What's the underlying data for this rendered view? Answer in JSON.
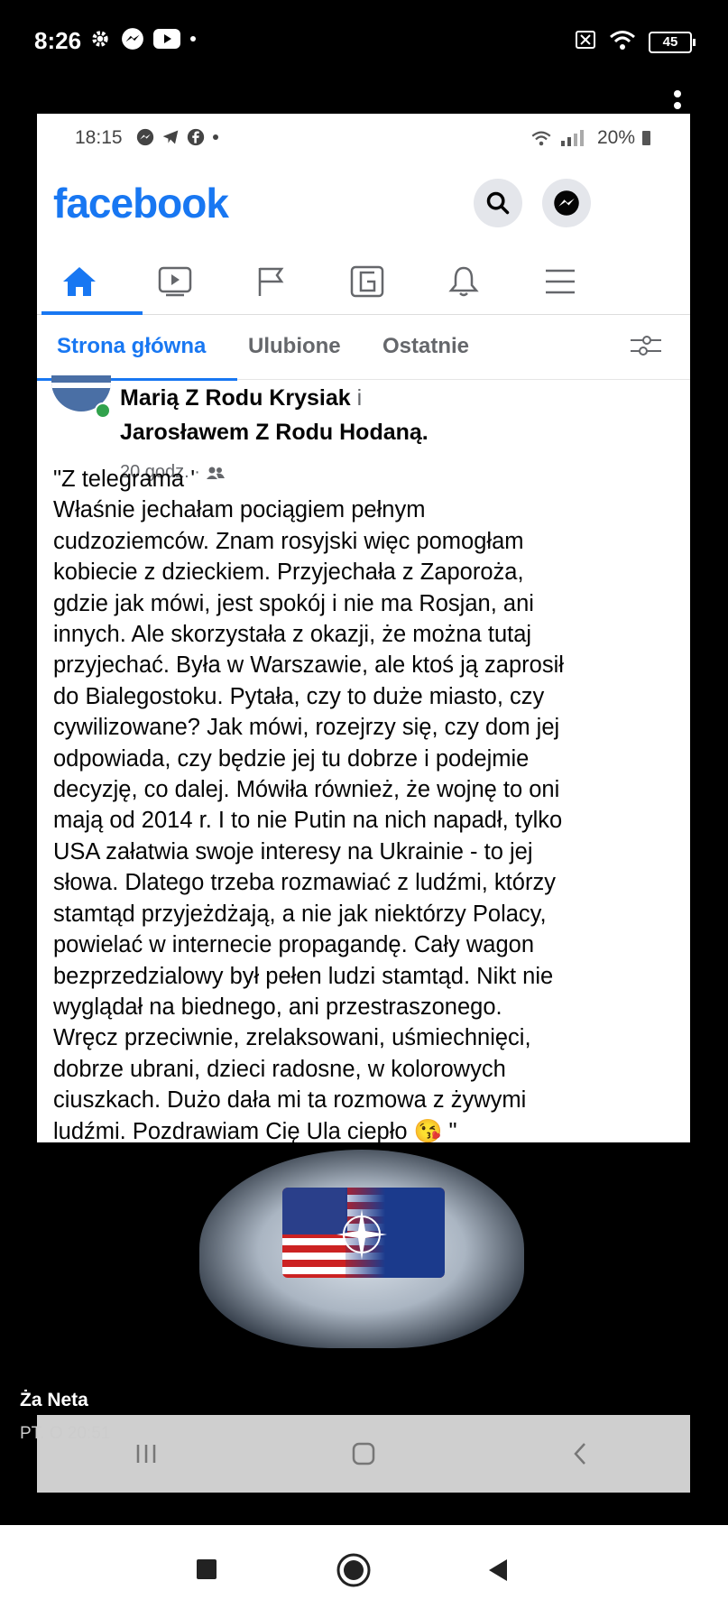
{
  "outer_status": {
    "time": "8:26",
    "battery": "45"
  },
  "inner_status": {
    "time": "18:15",
    "battery": "20%"
  },
  "facebook": {
    "logo": "facebook"
  },
  "subnav": {
    "tabs": [
      "Strona główna",
      "Ulubione",
      "Ostatnie"
    ]
  },
  "post": {
    "author_line_1": "Marią Z Rodu Krysiak",
    "author_sep": " i",
    "author_line_2": "Jarosławem Z Rodu Hodaną.",
    "time": "20 godz. ·",
    "text": "\"Z telegrama '\nWłaśnie jechałam pociągiem pełnym\ncudzoziemców. Znam rosyjski więc pomogłam\nkobiecie z dzieckiem. Przyjechała z Zaporoża,\ngdzie jak mówi, jest spokój i nie ma Rosjan, ani\ninnych. Ale skorzystała z okazji, że można tutaj\nprzyjechać. Była w Warszawie, ale ktoś ją zaprosił\ndo Bialegostoku. Pytała, czy to duże miasto, czy\ncywilizowane? Jak mówi, rozejrzy się, czy dom jej\nodpowiada, czy będzie jej tu dobrze i podejmie\ndecyzję, co dalej. Mówiła również, że wojnę to oni\nmają od 2014 r. I to nie Putin na nich napadł, tylko\nUSA załatwia swoje interesy na Ukrainie - to jej\nsłowa. Dlatego trzeba rozmawiać z ludźmi, którzy\nstamtąd przyjeżdżają, a nie jak niektórzy Polacy,\npowielać w internecie propagandę. Cały wagon\nbezprzedzialowy był pełen ludzi stamtąd. Nikt nie\nwyglądał na biednego, ani przestraszonego.\nWręcz przeciwnie, zrelaksowani, uśmiechnięci,\ndobrze ubrani, dzieci radosne, w kolorowych\nciuszkach. Dużo dała mi ta rozmowa z żywymi\nludźmi. Pozdrawiam Cię Ula ciepło 😘 \""
  },
  "message": {
    "sender": "Ża Neta",
    "time": "PT. O 20:51"
  },
  "colors": {
    "facebook_blue": "#1877f2",
    "text": "#050505",
    "secondary_text": "#65676b"
  }
}
